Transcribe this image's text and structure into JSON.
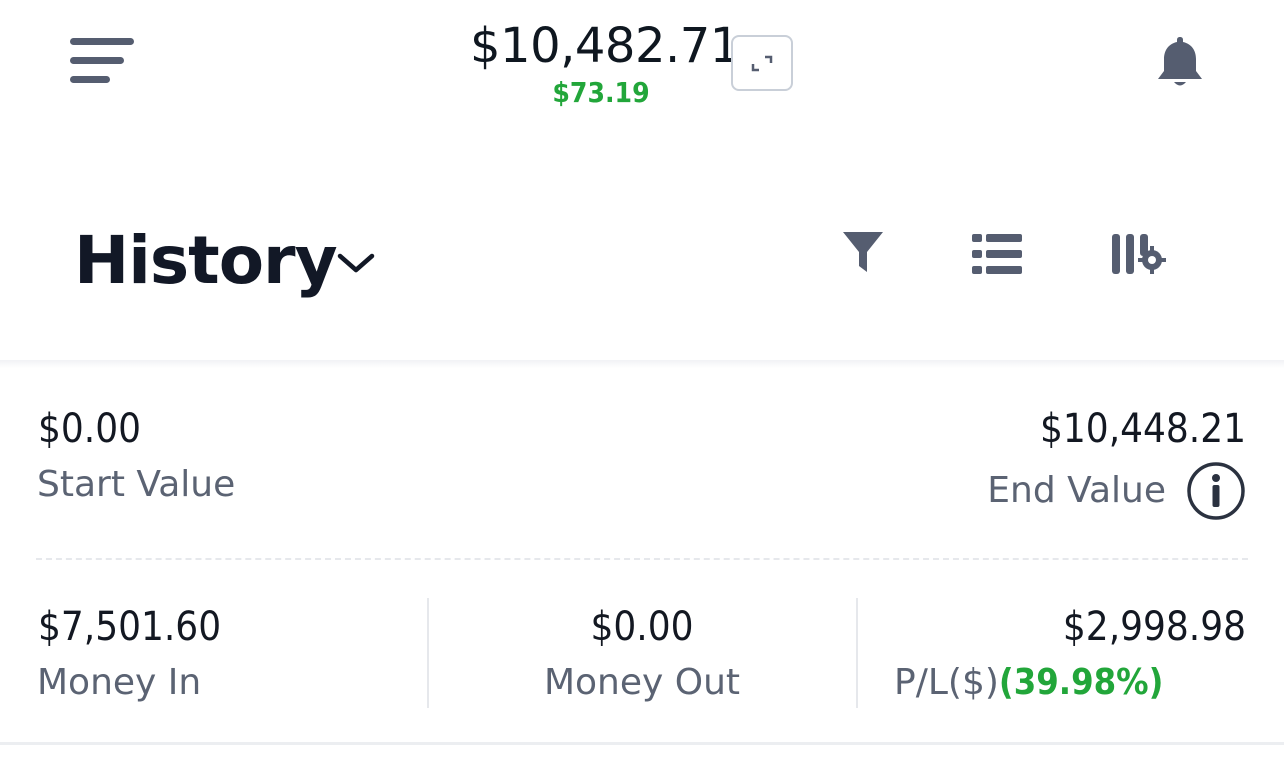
{
  "header": {
    "balance": "$10,482.71",
    "change": "$73.19",
    "icons": [
      "menu-icon",
      "expand-icon",
      "bell-icon"
    ]
  },
  "page": {
    "title": "History",
    "icons": [
      "chevron-down-icon",
      "filter-icon",
      "list-icon",
      "column-settings-icon"
    ]
  },
  "summary": {
    "start_value": "$0.00",
    "start_label": "Start Value",
    "end_value": "$10,448.21",
    "end_label": "End Value",
    "money_in_value": "$7,501.60",
    "money_in_label": "Money In",
    "money_out_value": "$0.00",
    "money_out_label": "Money Out",
    "pl_value": "$2,998.98",
    "pl_label": "P/L($)",
    "pl_percent": "(39.98%)"
  },
  "colors": {
    "positive": "#22a63a",
    "icon": "#555d70",
    "text": "#121826"
  }
}
